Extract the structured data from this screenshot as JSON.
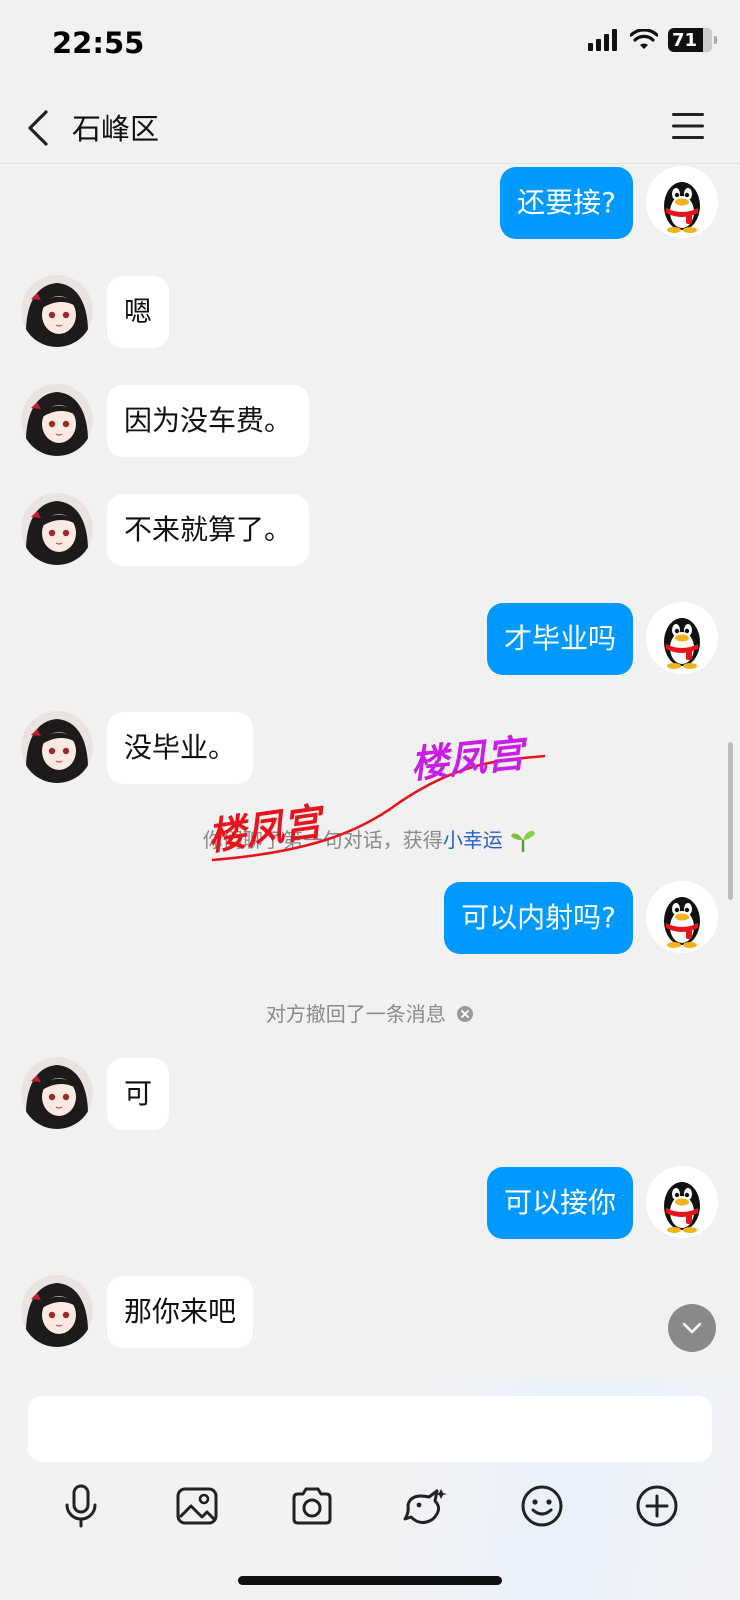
{
  "status_bar": {
    "time": "22:55",
    "battery": "71"
  },
  "nav": {
    "title": "石峰区"
  },
  "messages": [
    {
      "dir": "out",
      "text": "还要接?"
    },
    {
      "dir": "in",
      "text": "嗯"
    },
    {
      "dir": "in",
      "text": "因为没车费。"
    },
    {
      "dir": "in",
      "text": "不来就算了。"
    },
    {
      "dir": "out",
      "text": "才毕业吗"
    },
    {
      "dir": "in",
      "text": "没毕业。"
    },
    {
      "dir": "out",
      "text": "可以内射吗?"
    },
    {
      "dir": "in",
      "text": "可"
    },
    {
      "dir": "out",
      "text": "可以接你"
    },
    {
      "dir": "in",
      "text": "那你来吧"
    }
  ],
  "system": {
    "reward_prefix": "你们",
    "reward_hidden": "聊了第",
    "reward_middle": "一句对话，获得",
    "reward_link": "小幸运",
    "recall_notice": "对方撤回了一条消息"
  },
  "watermark": {
    "text_1": "楼凤宫",
    "text_2": "楼凤宫"
  },
  "toolbar": [
    "microphone-icon",
    "image-icon",
    "camera-icon",
    "bird-icon",
    "emoji-icon",
    "plus-icon"
  ],
  "colors": {
    "sent_bubble": "#0099ff",
    "received_bubble": "#ffffff",
    "background": "#f1f1f1",
    "link": "#2b5fc9",
    "watermark_red": "#e8141c",
    "watermark_purple": "#c81ee6"
  }
}
